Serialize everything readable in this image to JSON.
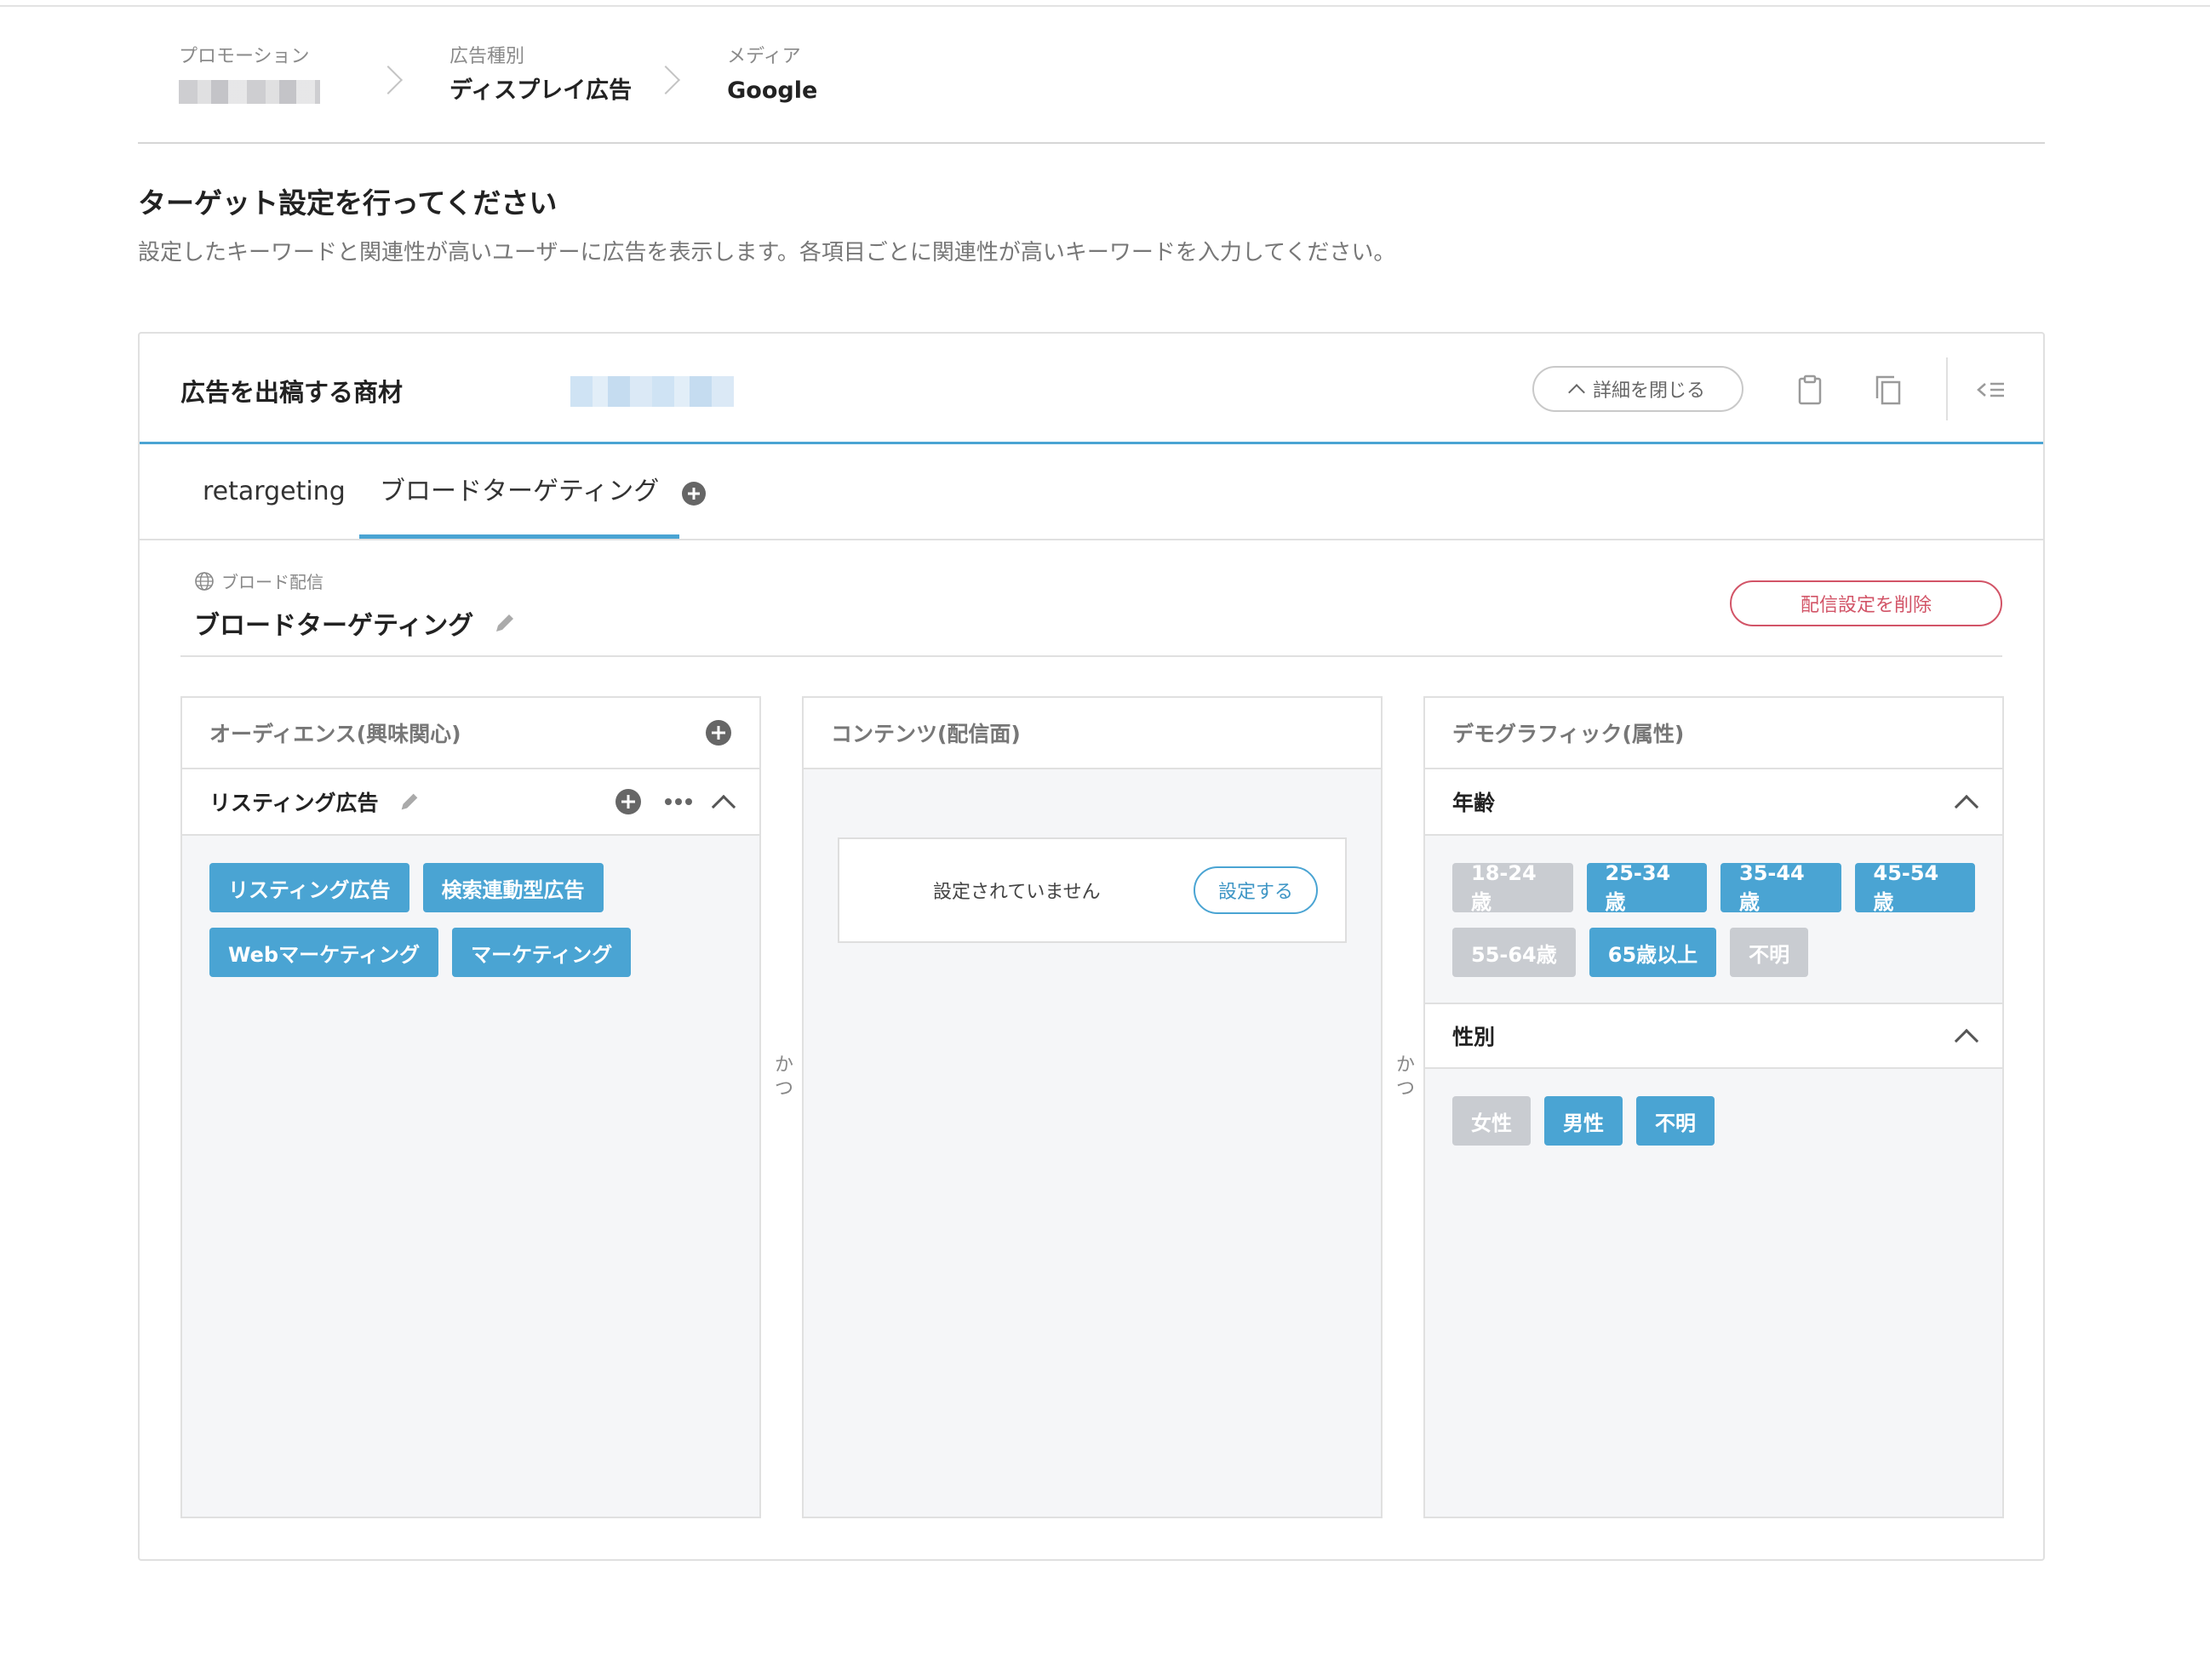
{
  "breadcrumb": {
    "items": [
      {
        "label": "プロモーション",
        "value": ""
      },
      {
        "label": "広告種別",
        "value": "ディスプレイ広告"
      },
      {
        "label": "メディア",
        "value": "Google"
      }
    ]
  },
  "page": {
    "title": "ターゲット設定を行ってください",
    "description": "設定したキーワードと関連性が高いユーザーに広告を表示します。各項目ごとに関連性が高いキーワードを入力してください。"
  },
  "card": {
    "product_label": "広告を出稿する商材",
    "details_button": "詳細を閉じる"
  },
  "tabs": [
    {
      "label": "retargeting",
      "active": false
    },
    {
      "label": "ブロードターゲティング",
      "active": true
    }
  ],
  "broad": {
    "type_label": "ブロード配信",
    "title": "ブロードターゲティング",
    "delete_button": "配信設定を削除"
  },
  "columns": {
    "audience": {
      "title": "オーディエンス(興味関心)",
      "group_title": "リスティング広告",
      "chip_rows": [
        [
          "リスティング広告",
          "検索連動型広告"
        ],
        [
          "Webマーケティング",
          "マーケティング"
        ]
      ]
    },
    "contents": {
      "title": "コンテンツ(配信面)",
      "empty_text": "設定されていません",
      "set_button": "設定する"
    },
    "demographic": {
      "title": "デモグラフィック(属性)",
      "age": {
        "title": "年齢",
        "rows": [
          [
            {
              "label": "18-24歳",
              "on": false
            },
            {
              "label": "25-34歳",
              "on": true
            },
            {
              "label": "35-44歳",
              "on": true
            },
            {
              "label": "45-54歳",
              "on": true
            }
          ],
          [
            {
              "label": "55-64歳",
              "on": false
            },
            {
              "label": "65歳以上",
              "on": true
            },
            {
              "label": "不明",
              "on": false
            }
          ]
        ]
      },
      "gender": {
        "title": "性別",
        "rows": [
          [
            {
              "label": "女性",
              "on": false
            },
            {
              "label": "男性",
              "on": true
            },
            {
              "label": "不明",
              "on": true
            }
          ]
        ]
      }
    }
  },
  "connector": {
    "line1": "か",
    "line2": "つ"
  },
  "colors": {
    "accent": "#4aa4d3",
    "danger": "#d25467",
    "chip_off": "#c9ccd1"
  }
}
